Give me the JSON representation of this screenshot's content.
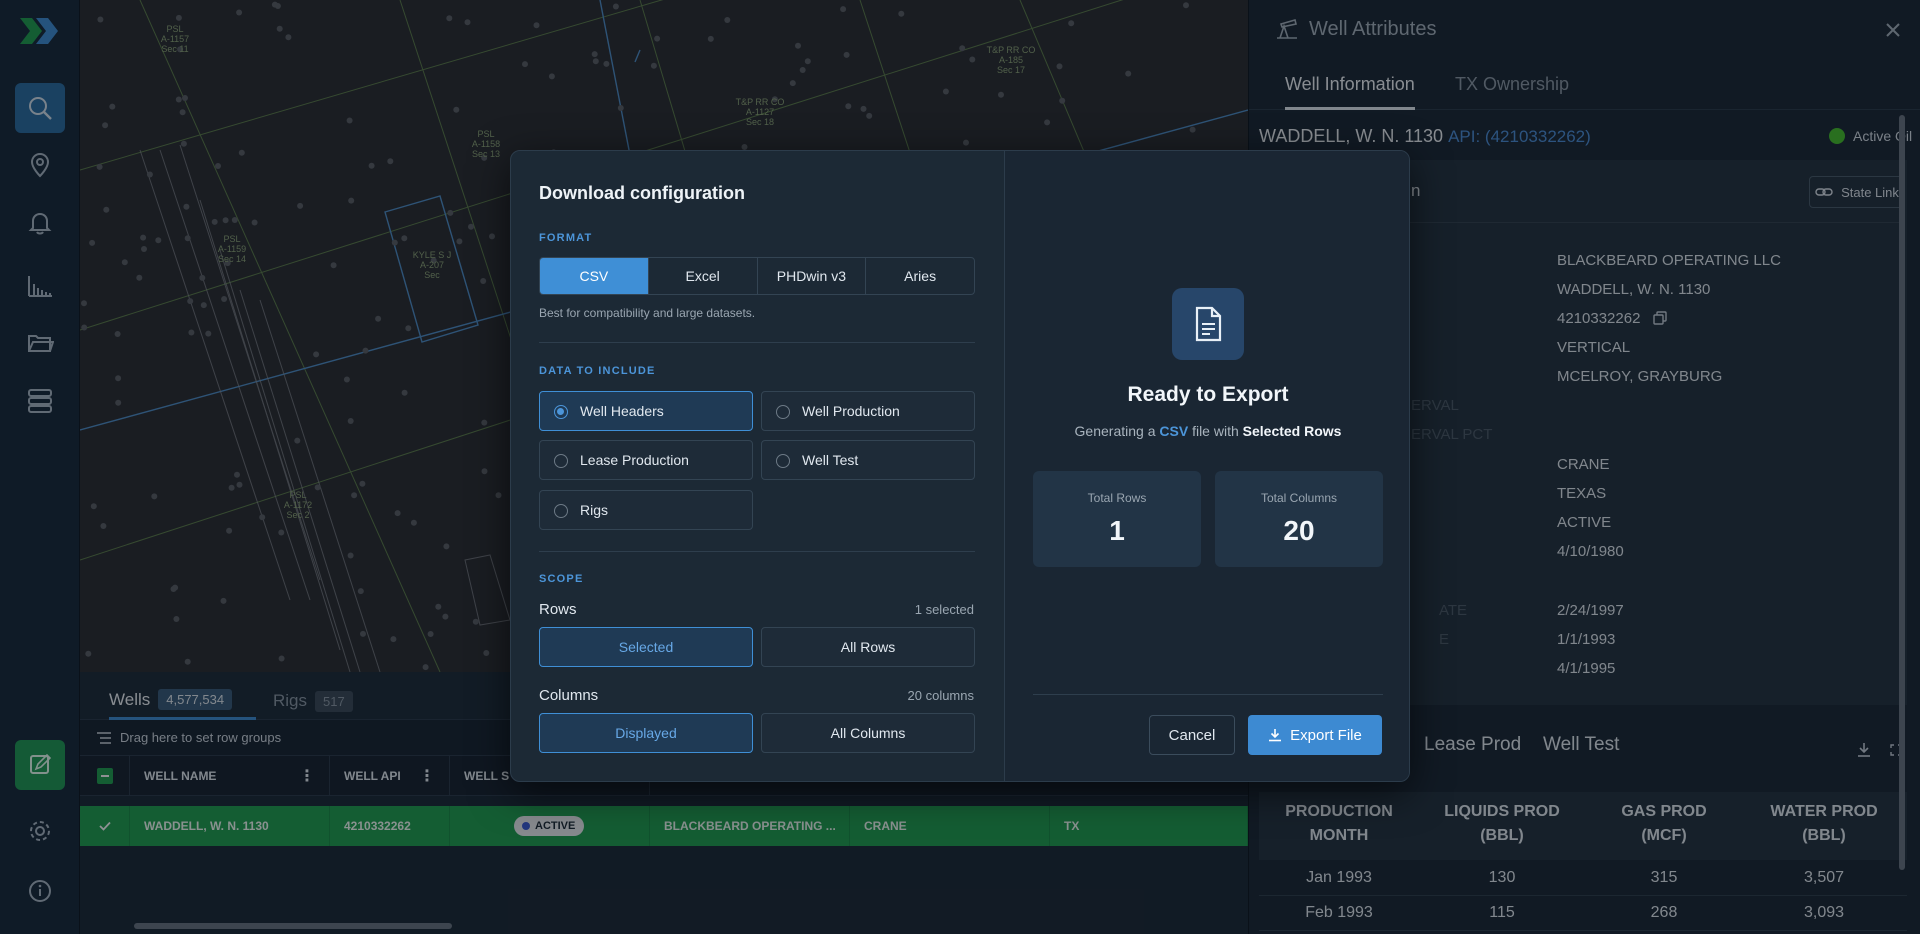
{
  "map": {
    "labels": [
      {
        "text": "PSL\nA-1157\nSec 11"
      },
      {
        "text": "PSL\nA-1158\nSec 13"
      },
      {
        "text": "PSL\nA-1159\nSec 14"
      },
      {
        "text": "PSL\nA-1172\nSec 2"
      },
      {
        "text": "T&P RR CO\nA-1127\nSec 18"
      },
      {
        "text": "T&P RR CO\nA-185\nSec 17"
      },
      {
        "text": "KYLE S J\nA-207\nSec"
      }
    ]
  },
  "grid": {
    "tabs": [
      {
        "label": "Wells",
        "count": "4,577,534"
      },
      {
        "label": "Rigs",
        "count": "517"
      }
    ],
    "group_hint": "Drag here to set row groups",
    "columns": [
      "WELL NAME",
      "WELL API",
      "WELL S"
    ],
    "row": {
      "well_name": "WADDELL, W. N. 1130",
      "api": "4210332262",
      "status": "ACTIVE",
      "operator": "BLACKBEARD OPERATING ...",
      "county": "CRANE",
      "state": "TX"
    }
  },
  "panel": {
    "title": "Well Attributes",
    "tabs": [
      "Well Information",
      "TX Ownership"
    ],
    "well_name": "WADDELL, W. N. 1130",
    "api_label": "API: (4210332262)",
    "status": "Active Oil",
    "section_title_tail": "n",
    "state_link": "State Link",
    "labels": [
      "ERVAL",
      "ERVAL PCT",
      "ATE",
      "E"
    ],
    "values": [
      "BLACKBEARD OPERATING LLC",
      "WADDELL, W. N. 1130",
      "4210332262",
      "VERTICAL",
      "MCELROY, GRAYBURG",
      "",
      "",
      "CRANE",
      "TEXAS",
      "ACTIVE",
      "4/10/1980",
      "",
      "2/24/1997",
      "1/1/1993",
      "4/1/1995"
    ],
    "prod_tabs": [
      "Lease Prod",
      "Well Test"
    ],
    "prod_headers": [
      "PRODUCTION\nMONTH",
      "LIQUIDS PROD\n(BBL)",
      "GAS PROD\n(MCF)",
      "WATER PROD\n(BBL)"
    ],
    "prod_rows": [
      [
        "Jan 1993",
        "130",
        "315",
        "3,507"
      ],
      [
        "Feb 1993",
        "115",
        "268",
        "3,093"
      ]
    ]
  },
  "modal": {
    "title": "Download configuration",
    "format_label": "FORMAT",
    "formats": [
      "CSV",
      "Excel",
      "PHDwin v3",
      "Aries"
    ],
    "selected_format": "CSV",
    "format_hint": "Best for compatibility and large datasets.",
    "data_label": "DATA TO INCLUDE",
    "data_options": [
      "Well Headers",
      "Well Production",
      "Lease Production",
      "Well Test",
      "Rigs"
    ],
    "selected_data": "Well Headers",
    "scope_label": "SCOPE",
    "rows_label": "Rows",
    "rows_note": "1 selected",
    "rows_options": [
      "Selected",
      "All Rows"
    ],
    "columns_label": "Columns",
    "columns_note": "20 columns",
    "columns_options": [
      "Displayed",
      "All Columns"
    ],
    "ready_title": "Ready to Export",
    "gen_prefix": "Generating a",
    "gen_format": "CSV",
    "gen_mid": "file with",
    "gen_scope": "Selected Rows",
    "stats": [
      {
        "label": "Total Rows",
        "value": "1"
      },
      {
        "label": "Total Columns",
        "value": "20"
      }
    ],
    "cancel": "Cancel",
    "export": "Export File"
  },
  "colors": {
    "accent": "#3f8fd6",
    "selected_row": "#1fa04f",
    "active_oil": "#45c12b"
  }
}
